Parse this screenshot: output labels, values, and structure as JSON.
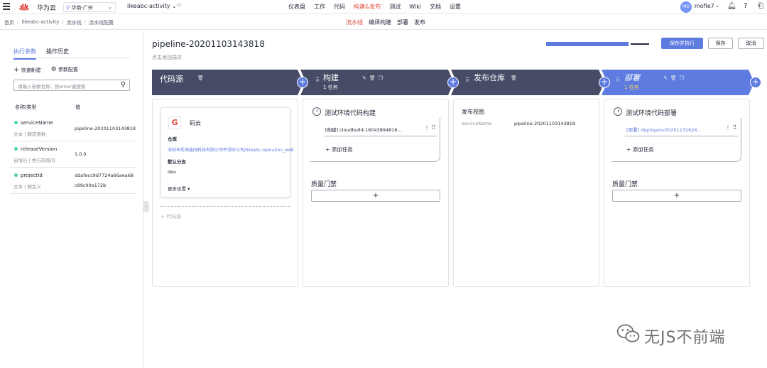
{
  "topbar": {
    "brand": "华为云",
    "region": "华南-广州",
    "project": "likeabc-activity ⌄",
    "nav": [
      "仪表盘",
      "工作",
      "代码",
      "构建&发布",
      "测试",
      "Wiki",
      "文档",
      "设置"
    ],
    "nav_active": "构建&发布",
    "avatar": "MO",
    "user": "mofie7"
  },
  "breadcrumb": [
    "首页",
    "likeabc-activity",
    "流水线",
    "流水线配置"
  ],
  "subnav": [
    "流水线",
    "编译构建",
    "部署",
    "发布"
  ],
  "left": {
    "tabs": [
      "执行参数",
      "操作历史"
    ],
    "quick_new": "快速新建",
    "param_config": "参数配置",
    "search_placeholder": "请输入参数名称，按enter键搜索",
    "col_name": "名称/类型",
    "col_value": "值",
    "params": [
      {
        "name": "serviceName",
        "type": "文本 | 静态参数",
        "value": "pipeline-20201103143818"
      },
      {
        "name": "releaseVersion",
        "type": "自增长 | 执行前询问",
        "value": "1.0.0"
      },
      {
        "name": "projectId",
        "type": "文本 | 预定义",
        "value": "ddafecc9d7724a66aea68",
        "value2": "c89c00e172b"
      }
    ]
  },
  "header": {
    "title": "pipeline-20201103143818",
    "desc": "点击添加描述",
    "progress": 0.8,
    "btn_save_run": "保存并执行",
    "btn_save": "保存",
    "btn_cancel": "取消"
  },
  "stages": [
    {
      "label": "代码源",
      "count": ""
    },
    {
      "label": "构建",
      "count": "1 任务"
    },
    {
      "label": "发布仓库",
      "count": ""
    },
    {
      "label": "部署",
      "count": "1 任务"
    }
  ],
  "source_card": {
    "name": "码云",
    "repo_label": "仓库",
    "repo_link": "深圳市前海鑫网科技有限公司平湖分公司/likeabc-operation_web",
    "branch_label": "默认分支",
    "branch": "dev",
    "more": "更多设置 ▾",
    "add_source": "+ 代码源"
  },
  "build_col": {
    "job_title": "测试环境代码构建",
    "task": "[构建] cloudbuild-16043894816...",
    "add_task": "+ 添加任务",
    "gate_title": "质量门禁",
    "gate_add": "+"
  },
  "release_col": {
    "title": "发布视图",
    "key": "serviceName",
    "value": "pipeline-20201103143818"
  },
  "deploy_col": {
    "job_title": "测试环境代码部署",
    "task": "[部署] deployenv20201131624...",
    "add_task": "+ 添加任务",
    "gate_title": "质量门禁",
    "gate_add": "+"
  },
  "watermark": "无JS不前端",
  "colors": {
    "accent": "#5e7ce0",
    "stage_dark": "#464c66",
    "active_nav": "#e04d3d",
    "status_dot": "#50d4ab"
  }
}
